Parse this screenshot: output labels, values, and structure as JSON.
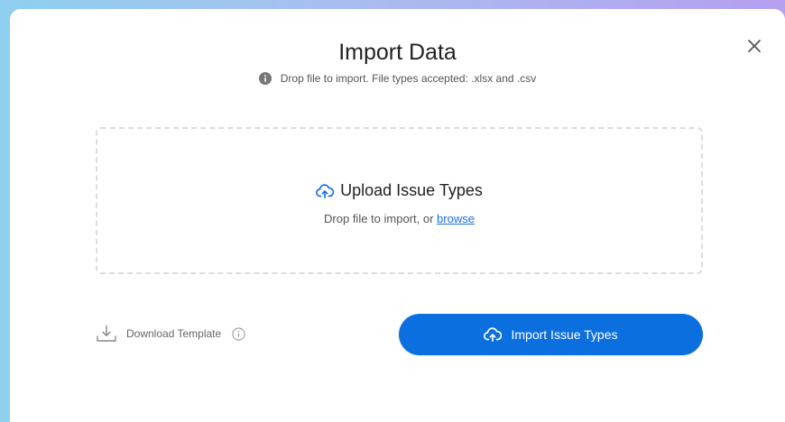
{
  "modal": {
    "title": "Import Data",
    "subtitle": "Drop file to import. File types accepted: .xlsx and .csv",
    "close_icon": "close-icon"
  },
  "dropzone": {
    "heading": "Upload Issue Types",
    "prompt": "Drop file to import, or",
    "browse_label": "browse",
    "icon": "cloud-upload-icon"
  },
  "footer": {
    "download_label": "Download Template",
    "import_button_label": "Import Issue Types"
  },
  "colors": {
    "accent": "#0b6fe0",
    "link": "#1a6fe0",
    "title_text": "#222222",
    "muted_text": "#666666"
  }
}
